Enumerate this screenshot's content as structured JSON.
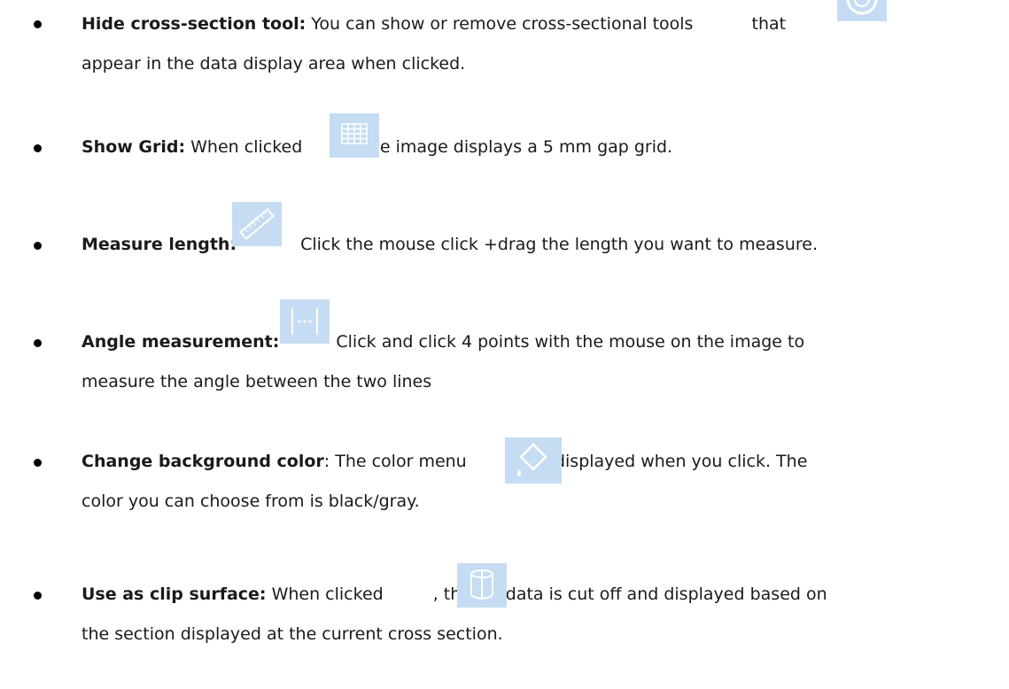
{
  "items": [
    {
      "label": "Hide cross-section tool:",
      "text_before": " You can show or remove cross-sectional tools ",
      "text_after": "that",
      "line2": "appear in the data display area when clicked.",
      "icon": "cross-section-icon"
    },
    {
      "label": "Show Grid:",
      "text_before": " When clicked",
      "text_after": ",  the image displays a 5 mm gap grid.",
      "icon": "grid-icon"
    },
    {
      "label": "Measure length:",
      "text_before": " ",
      "text_after": "Click the mouse click +drag the length you want to measure.",
      "icon": "ruler-icon"
    },
    {
      "label": "Angle measurement:",
      "text_before": " ",
      "text_after": "Click and click 4 points with the mouse on the image to",
      "line2": "measure the angle between the two lines",
      "icon": "angle-measure-icon"
    },
    {
      "label": "Change background color",
      "text_before": ": The color menu",
      "text_after": "is displayed when you click. The",
      "line2": "color you can choose from is black/gray.",
      "icon": "paint-bucket-icon"
    },
    {
      "label": "Use as clip surface:",
      "text_before": " When clicked",
      "text_after": ",  the 3D data is cut off and displayed based on",
      "line2": "the section displayed at the current cross section.",
      "icon": "clip-surface-icon"
    }
  ]
}
